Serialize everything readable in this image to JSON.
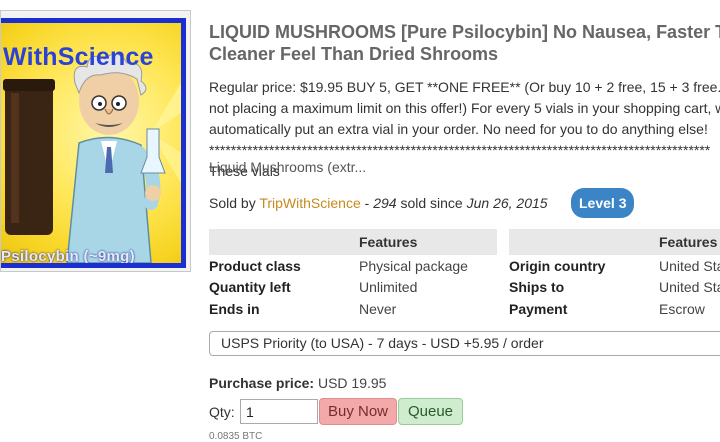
{
  "product": {
    "title": "LIQUID MUSHROOMS [Pure Psilocybin] No Nausea, Faster Trip, Cleaner Feel Than Dried Shrooms",
    "image": {
      "brand_text": "WithScience",
      "caption": "Psilocybin (~9mg)"
    },
    "description": "Regular price: $19.95 BUY 5, GET **ONE FREE** (Or buy 10 + 2 free, 15 + 3 free... not placing a maximum limit on this offer!) For every 5 vials in your shopping cart, we'll automatically put an extra vial in your order. No need for you to do anything else! ******************************************************************************************** These vials",
    "short_description": "Liquid Mushrooms (extr..."
  },
  "seller": {
    "prefix": "Sold by",
    "name": "TripWithScience",
    "separator": " - ",
    "sold_count": "294",
    "sold_text": " sold since ",
    "since_date": "Jun 26, 2015",
    "level": "Level 3"
  },
  "features_left": {
    "header": "Features",
    "rows": [
      {
        "key": "Product class",
        "value": "Physical package"
      },
      {
        "key": "Quantity left",
        "value": "Unlimited"
      },
      {
        "key": "Ends in",
        "value": "Never"
      }
    ]
  },
  "features_right": {
    "header": "Features",
    "rows": [
      {
        "key": "Origin country",
        "value": "United States"
      },
      {
        "key": "Ships to",
        "value": "United States"
      },
      {
        "key": "Payment",
        "value": "Escrow"
      }
    ]
  },
  "shipping": {
    "selected": "USPS Priority (to USA) - 7 days - USD +5.95 / order"
  },
  "purchase": {
    "price_label": "Purchase price:",
    "price_value": "USD 19.95",
    "qty_label": "Qty:",
    "qty_value": "1",
    "buy_label": "Buy Now",
    "queue_label": "Queue",
    "btc_value": "0.0835 BTC"
  },
  "colors": {
    "seller_link": "#c78a1e",
    "level_badge": "#3b85c6",
    "buy_button": "#f3a9a9",
    "queue_button": "#cfeccf"
  }
}
